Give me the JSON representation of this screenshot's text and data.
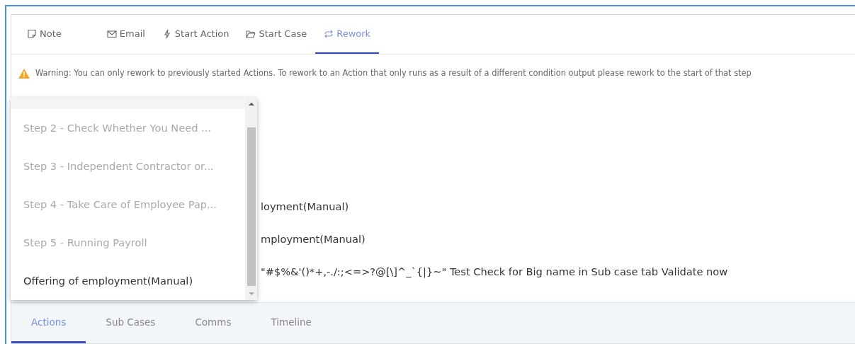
{
  "action_tabs": [
    {
      "label": "Note",
      "selected": false
    },
    {
      "label": "Email",
      "selected": false
    },
    {
      "label": "Start Action",
      "selected": false
    },
    {
      "label": "Start Case",
      "selected": false
    },
    {
      "label": "Rework",
      "selected": true
    }
  ],
  "warning": "Warning: You can only rework to previously started Actions. To rework to an Action that only runs as a result of a different condition output please rework to the start of that step",
  "background_options": [
    "loyment(Manual)",
    "mployment(Manual)",
    "\"#$%&'()*+,-./:;<=>?@[\\]^_`{|}~\" Test Check for Big name in Sub case tab Validate now"
  ],
  "dropdown": {
    "items": [
      {
        "label": "Step 2 - Check Whether You Need ...",
        "disabled": true
      },
      {
        "label": "Step 3 - Independent Contractor or...",
        "disabled": true
      },
      {
        "label": "Step 4 - Take Care of Employee Pap...",
        "disabled": true
      },
      {
        "label": "Step 5 - Running Payroll",
        "disabled": true
      },
      {
        "label": "Offering of employment(Manual)",
        "disabled": false
      }
    ]
  },
  "case_tabs": [
    {
      "label": "Actions",
      "selected": true
    },
    {
      "label": "Sub Cases",
      "selected": false
    },
    {
      "label": "Comms",
      "selected": false
    },
    {
      "label": "Timeline",
      "selected": false
    }
  ]
}
